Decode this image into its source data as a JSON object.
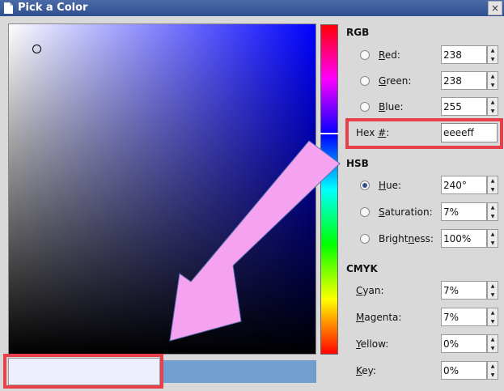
{
  "window": {
    "title": "Pick a Color",
    "close_glyph": "×",
    "icon": "document-icon"
  },
  "color": {
    "current_hex_color": "#eeeeff",
    "original_swatch_color": "#6f9ecf"
  },
  "rgb": {
    "heading": "RGB",
    "red": {
      "label_key": "R",
      "label_rest": "ed:",
      "value": "238"
    },
    "green": {
      "label_key": "G",
      "label_rest": "reen:",
      "value": "238"
    },
    "blue": {
      "label_key": "B",
      "label_rest": "lue:",
      "value": "255"
    },
    "hex": {
      "label_pre": "Hex ",
      "label_key": "#",
      "label_post": ":",
      "value": "eeeeff"
    }
  },
  "hsb": {
    "heading": "HSB",
    "hue": {
      "label_key": "H",
      "label_rest": "ue:",
      "value": "240°",
      "selected": true
    },
    "saturation": {
      "label_key": "S",
      "label_rest": "aturation:",
      "value": "7%"
    },
    "brightness": {
      "label_pre": "Bright",
      "label_key": "n",
      "label_rest": "ess:",
      "value": "100%"
    }
  },
  "cmyk": {
    "heading": "CMYK",
    "cyan": {
      "label_key": "C",
      "label_rest": "yan:",
      "value": "7%"
    },
    "magenta": {
      "label_key": "M",
      "label_rest": "agenta:",
      "value": "7%"
    },
    "yellow": {
      "label_key": "Y",
      "label_rest": "ellow:",
      "value": "0%"
    },
    "key": {
      "label_key": "K",
      "label_rest": "ey:",
      "value": "0%"
    }
  },
  "annotations": {
    "highlight_color": "#e8404a",
    "arrow_color": "#f5a3f0"
  }
}
